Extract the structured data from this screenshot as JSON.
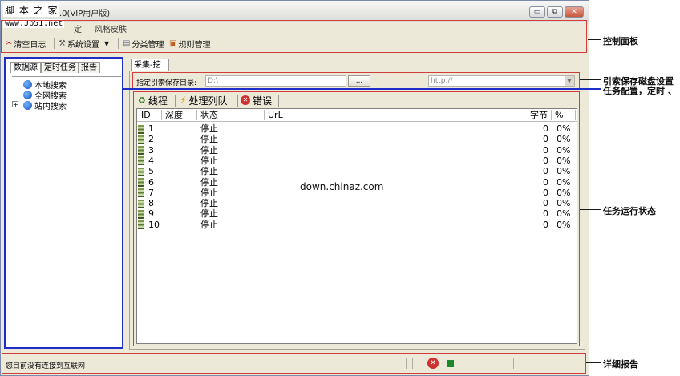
{
  "app": {
    "title_suffix": ".0(VIP用户版)",
    "watermark_logo": "脚 本 之 家",
    "watermark_url": "www.Jb51.net",
    "watermark_center": "down.chinaz.com"
  },
  "window_buttons": {
    "minimize": "▭",
    "restore": "⧉",
    "close": "✕"
  },
  "menu": {
    "item1": "定",
    "item2": "风格皮肤"
  },
  "toolbar": {
    "clear_log": "清空日志",
    "system_settings": "系统设置",
    "dropdown_arrow": "▼",
    "category_manage": "分类管理",
    "rule_manage": "规则管理"
  },
  "left_tabs": [
    "数据源",
    "定时任务",
    "报告"
  ],
  "tree": {
    "local_search": "本地搜索",
    "web_search": "全网搜索",
    "site_search": "站内搜索",
    "expand": "+"
  },
  "main_tab": "采集-挖掘",
  "save": {
    "label": "指定引索保存目录:",
    "path_value": "D:\\",
    "browse_button": "...",
    "url_value": "http://",
    "url_dropdown": "▼"
  },
  "inner_tabs": {
    "threads": "线程",
    "queue": "处理列队",
    "errors": "错误"
  },
  "table": {
    "headers": [
      "ID",
      "深度",
      "状态",
      "UrL",
      "字节",
      "%"
    ],
    "rows": [
      {
        "id": "1",
        "status": "停止",
        "bytes": "0",
        "pct": "0%"
      },
      {
        "id": "2",
        "status": "停止",
        "bytes": "0",
        "pct": "0%"
      },
      {
        "id": "3",
        "status": "停止",
        "bytes": "0",
        "pct": "0%"
      },
      {
        "id": "4",
        "status": "停止",
        "bytes": "0",
        "pct": "0%"
      },
      {
        "id": "5",
        "status": "停止",
        "bytes": "0",
        "pct": "0%"
      },
      {
        "id": "6",
        "status": "停止",
        "bytes": "0",
        "pct": "0%"
      },
      {
        "id": "7",
        "status": "停止",
        "bytes": "0",
        "pct": "0%"
      },
      {
        "id": "8",
        "status": "停止",
        "bytes": "0",
        "pct": "0%"
      },
      {
        "id": "9",
        "status": "停止",
        "bytes": "0",
        "pct": "0%"
      },
      {
        "id": "10",
        "status": "停止",
        "bytes": "0",
        "pct": "0%"
      }
    ]
  },
  "status_bar": {
    "message": "您目前没有连接到互联网"
  },
  "annotations": {
    "control_panel": "控制面板",
    "index_save": "引索保存磁盘设置",
    "task_config": "任务配置，定时 、",
    "run_status": "任务运行状态",
    "detail_report": "详细报告"
  },
  "colors": {
    "annotation_box": "#d13c3c",
    "left_box": "#1f2ec8",
    "window_bg": "#ece9d8"
  }
}
